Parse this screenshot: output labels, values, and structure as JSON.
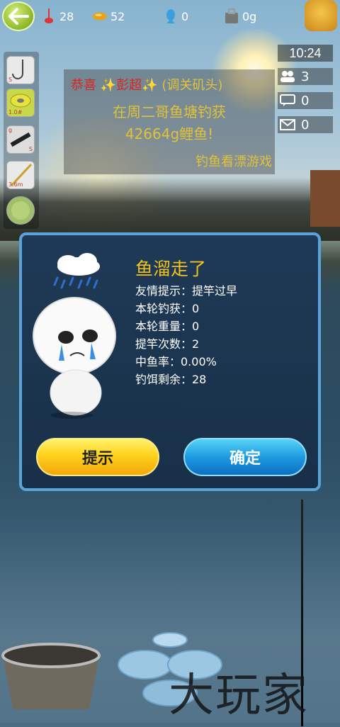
{
  "topbar": {
    "float_count": "28",
    "fish_food": "52",
    "fish_count": "0",
    "weight": "0g"
  },
  "tools": {
    "hook_label": "S",
    "line_label": "1.0#",
    "reel_label_top": "g",
    "reel_label_bottom": "S",
    "rod_label": "3.6m"
  },
  "right_panel": {
    "time": "10:24",
    "players": "3",
    "chats": "0",
    "mails": "0"
  },
  "announcement": {
    "congrats": "恭喜",
    "player_name": "彭超",
    "player_title": "(调关矶头)",
    "line2": "在周二哥鱼塘钓获",
    "line3": "42664g鲤鱼!",
    "link": "钓鱼看漂游戏"
  },
  "dialog": {
    "title": "鱼溜走了",
    "rows": [
      "友情提示：提竿过早",
      "本轮钓获：0",
      "本轮重量：0",
      "提竿次数：2",
      "中鱼率：0.00%",
      "钓饵剩余：28"
    ],
    "hint_button": "提示",
    "ok_button": "确定"
  },
  "watermark": "大玩家",
  "colors": {
    "dialog_border": "#5aa3dd",
    "title_yellow": "#f2c21a",
    "announce_gold": "#e0c23a",
    "announce_red": "#d7261e"
  }
}
